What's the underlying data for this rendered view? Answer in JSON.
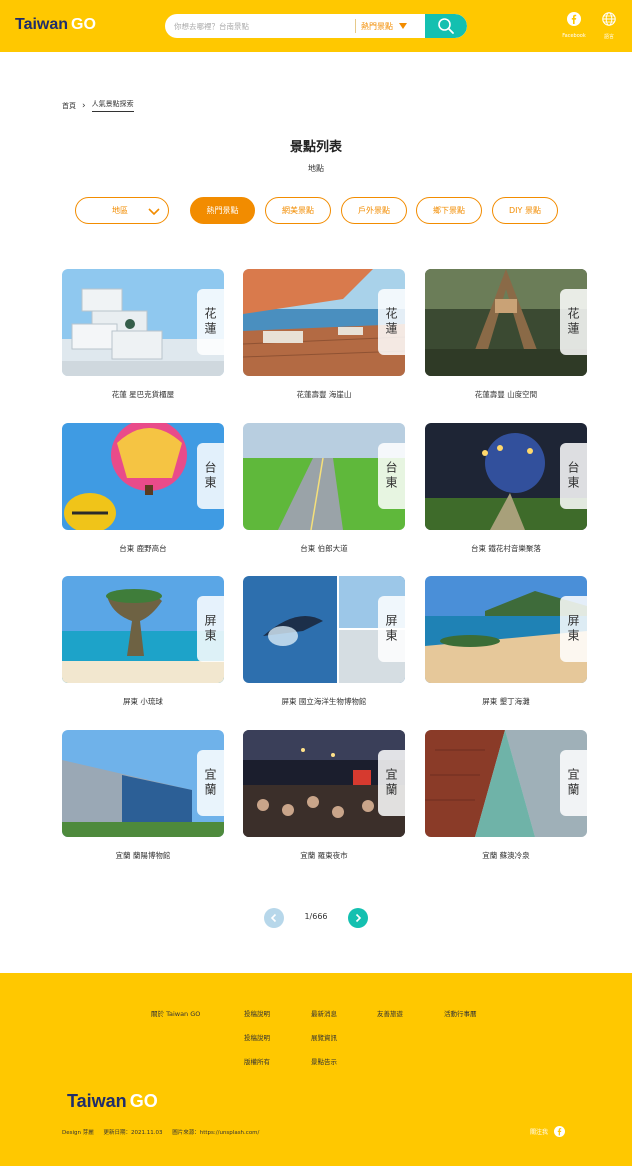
{
  "header": {
    "logo_main": "Taiwan",
    "logo_go": "GO",
    "search_placeholder": "你想去哪裡？台南景點",
    "search_category": "熱門景點",
    "facebook_label": "Facebook",
    "language_label": "語言",
    "colors": {
      "brand_yellow": "#ffc800",
      "accent_orange": "#f28c00",
      "teal": "#14c0b0",
      "navy": "#1f2d6b"
    }
  },
  "breadcrumb": {
    "home": "首頁",
    "current": "人氣景點探索"
  },
  "page": {
    "title": "景點列表",
    "subtitle": "地點"
  },
  "filters": {
    "region": "地區",
    "tags": [
      "熱門景點",
      "網美景點",
      "戶外景點",
      "鄉下景點",
      "DIY 景點"
    ],
    "active_tag": "熱門景點"
  },
  "cards": [
    {
      "region": "花蓮",
      "caption": "花蓮 星巴克貨櫃屋",
      "icon": "photo"
    },
    {
      "region": "花蓮",
      "caption": "花蓮壽豐 海崖山",
      "icon": "photo"
    },
    {
      "region": "花蓮",
      "caption": "花蓮壽豐 山度空間",
      "icon": "photo"
    },
    {
      "region": "台東",
      "caption": "台東 鹿野高台",
      "icon": "photo"
    },
    {
      "region": "台東",
      "caption": "台東 伯郎大道",
      "icon": "photo"
    },
    {
      "region": "台東",
      "caption": "台東 鐵花村音樂聚落",
      "icon": "photo"
    },
    {
      "region": "屏東",
      "caption": "屏東 小琉球",
      "icon": "photo"
    },
    {
      "region": "屏東",
      "caption": "屏東 國立海洋生物博物館",
      "icon": "photo"
    },
    {
      "region": "屏東",
      "caption": "屏東 墾丁海灘",
      "icon": "photo"
    },
    {
      "region": "宜蘭",
      "caption": "宜蘭 蘭陽博物館",
      "icon": "photo"
    },
    {
      "region": "宜蘭",
      "caption": "宜蘭 羅東夜市",
      "icon": "photo"
    },
    {
      "region": "宜蘭",
      "caption": "宜蘭 蘇澳冷泉",
      "icon": "photo"
    }
  ],
  "pagination": {
    "text": "1/666"
  },
  "footer": {
    "about": "關於 Taiwan GO",
    "col1": [
      "投稿說明",
      "投稿說明",
      "版權所有"
    ],
    "col2": [
      "最新消息",
      "展覽資訊",
      "景點告示"
    ],
    "col3": "友善旅遊",
    "col4": "活動行事曆",
    "logo_main": "Taiwan",
    "logo_go": "GO",
    "design": "Design 芽麗",
    "updated": "更新日期：2021.11.03",
    "source": "圖片來源：https://unsplash.com/",
    "follow": "關注我"
  }
}
